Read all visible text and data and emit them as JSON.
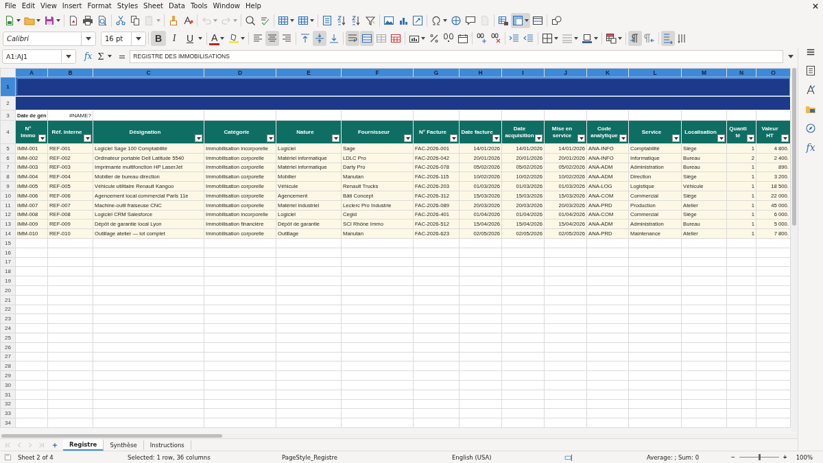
{
  "menu": [
    "File",
    "Edit",
    "View",
    "Insert",
    "Format",
    "Styles",
    "Sheet",
    "Data",
    "Tools",
    "Window",
    "Help"
  ],
  "toolbar_state": {
    "paste_enabled": false,
    "undo_enabled": false,
    "redo_enabled": false,
    "freeze_active": true
  },
  "font": {
    "name": "Calibri",
    "size": "16 pt"
  },
  "text_style_buttons": [
    {
      "label": "B",
      "kind": "bold",
      "on": true
    },
    {
      "label": "I",
      "kind": "italic",
      "on": false
    },
    {
      "label": "U",
      "kind": "underline",
      "on": false
    }
  ],
  "font_color": {
    "label": "A"
  },
  "format_state": {
    "align_left": false,
    "align_center": true,
    "align_right": false,
    "align_top": false,
    "align_middle": true,
    "align_bottom": false,
    "wrap": true,
    "merge": true,
    "left_to_right": true,
    "right_to_left": false,
    "text_horizontal": true,
    "text_vertical": false
  },
  "formula_bar": {
    "name_box": "A1:AJ1",
    "function_wizard": "fx",
    "sum": "Σ",
    "equals": "=",
    "content": "REGISTRE DES IMMOBILISATIONS"
  },
  "columns": [
    {
      "label": "A",
      "selected": true
    },
    {
      "label": "B",
      "selected": true
    },
    {
      "label": "C",
      "selected": true
    },
    {
      "label": "D",
      "selected": true
    },
    {
      "label": "E",
      "selected": true
    },
    {
      "label": "F",
      "selected": true
    },
    {
      "label": "G",
      "selected": true
    },
    {
      "label": "H",
      "selected": true
    },
    {
      "label": "I",
      "selected": true
    },
    {
      "label": "J",
      "selected": true
    },
    {
      "label": "K",
      "selected": true
    },
    {
      "label": "L",
      "selected": true
    },
    {
      "label": "M",
      "selected": true
    },
    {
      "label": "N",
      "selected": true
    },
    {
      "label": "O",
      "selected": true
    }
  ],
  "banner_rows": [
    {
      "number": "1",
      "selected": true
    },
    {
      "number": "2",
      "selected": false
    }
  ],
  "info_row": {
    "number": "3",
    "label": "Date de gén",
    "value": "#NAME?"
  },
  "header_row": {
    "number": "4",
    "cells": [
      "N° Immo",
      "Réf. interne",
      "Désignation",
      "Catégorie",
      "Nature",
      "Fournisseur",
      "N° Facture",
      "Date facture",
      "Date acquisition",
      "Mise en service",
      "Code analytique",
      "Service",
      "Localisation",
      "Quanti té",
      "Valeur HT"
    ]
  },
  "data_rows": [
    {
      "number": "5",
      "cells": [
        "IMM-001",
        "REF-001",
        "Logiciel Sage 100 Comptabilité",
        "Immobilisation incorporelle",
        "Logiciel",
        "Sage",
        "FAC-2026-001",
        "14/01/2026",
        "14/01/2026",
        "14/01/2026",
        "ANA-INFO",
        "Comptabilité",
        "Siège",
        "1",
        "4 800."
      ]
    },
    {
      "number": "6",
      "cells": [
        "IMM-002",
        "REF-002",
        "Ordinateur portable Dell Latitude 5540",
        "Immobilisation corporelle",
        "Matériel informatique",
        "LDLC Pro",
        "FAC-2026-042",
        "20/01/2026",
        "20/01/2026",
        "20/01/2026",
        "ANA-INFO",
        "Informatique",
        "Bureau",
        "2",
        "2 400."
      ]
    },
    {
      "number": "7",
      "cells": [
        "IMM-003",
        "REF-003",
        "Imprimante multifonction HP LaserJet",
        "Immobilisation corporelle",
        "Matériel informatique",
        "Darty Pro",
        "FAC-2026-078",
        "05/02/2026",
        "05/02/2026",
        "05/02/2026",
        "ANA-ADM",
        "Administration",
        "Bureau",
        "1",
        "890."
      ]
    },
    {
      "number": "8",
      "cells": [
        "IMM-004",
        "REF-004",
        "Mobilier de bureau direction",
        "Immobilisation corporelle",
        "Mobilier",
        "Manutan",
        "FAC-2026-115",
        "10/02/2026",
        "10/02/2026",
        "10/02/2026",
        "ANA-ADM",
        "Direction",
        "Siège",
        "1",
        "3 200."
      ]
    },
    {
      "number": "9",
      "cells": [
        "IMM-005",
        "REF-005",
        "Véhicule utilitaire Renault Kangoo",
        "Immobilisation corporelle",
        "Véhicule",
        "Renault Trucks",
        "FAC-2026-203",
        "01/03/2026",
        "01/03/2026",
        "01/03/2026",
        "ANA-LOG",
        "Logistique",
        "Véhicule",
        "1",
        "18 500."
      ]
    },
    {
      "number": "10",
      "cells": [
        "IMM-006",
        "REF-006",
        "Agencement local commercial Paris 11e",
        "Immobilisation corporelle",
        "Agencement",
        "Bâti Concept",
        "FAC-2026-312",
        "15/03/2026",
        "15/03/2026",
        "15/03/2026",
        "ANA-COM",
        "Commercial",
        "Siège",
        "1",
        "22 000."
      ]
    },
    {
      "number": "11",
      "cells": [
        "IMM-007",
        "REF-007",
        "Machine-outil fraiseuse CNC",
        "Immobilisation corporelle",
        "Matériel industriel",
        "Leclerc Pro Industrie",
        "FAC-2026-089",
        "20/03/2026",
        "20/03/2026",
        "20/03/2026",
        "ANA-PRD",
        "Production",
        "Atelier",
        "1",
        "45 000."
      ]
    },
    {
      "number": "12",
      "cells": [
        "IMM-008",
        "REF-008",
        "Logiciel CRM Salesforce",
        "Immobilisation incorporelle",
        "Logiciel",
        "Cegid",
        "FAC-2026-401",
        "01/04/2026",
        "01/04/2026",
        "01/04/2026",
        "ANA-COM",
        "Commercial",
        "Siège",
        "1",
        "6 000."
      ]
    },
    {
      "number": "13",
      "cells": [
        "IMM-009",
        "REF-009",
        "Dépôt de garantie local Lyon",
        "Immobilisation financière",
        "Dépôt de garantie",
        "SCI Rhône Immo",
        "FAC-2026-512",
        "15/04/2026",
        "15/04/2026",
        "15/04/2026",
        "ANA-ADM",
        "Administration",
        "Bureau",
        "1",
        "5 000."
      ]
    },
    {
      "number": "14",
      "cells": [
        "IMM-010",
        "REF-010",
        "Outillage atelier — lot complet",
        "Immobilisation corporelle",
        "Outillage",
        "Manutan",
        "FAC-2026-623",
        "02/05/2026",
        "02/05/2026",
        "02/05/2026",
        "ANA-PRD",
        "Maintenance",
        "Atelier",
        "1",
        "7 800."
      ]
    }
  ],
  "empty_row_numbers": [
    "15",
    "16",
    "17",
    "18",
    "19",
    "20",
    "21",
    "22",
    "23",
    "24",
    "25",
    "26",
    "27",
    "28",
    "29",
    "30",
    "31",
    "32",
    "33",
    "34"
  ],
  "sidebar": {
    "functions": "fx"
  },
  "sheet_tabs": [
    {
      "label": "Registre",
      "selected": true
    },
    {
      "label": "Synthèse",
      "selected": false
    },
    {
      "label": "Instructions",
      "selected": false
    }
  ],
  "status_bar": {
    "sheet": "Sheet 2 of 4",
    "selection": "Selected: 1 row, 36 columns",
    "page_style": "PageStyle_Registre",
    "language": "English (USA)",
    "summary": "Average: ; Sum: 0",
    "zoom_out": "−",
    "zoom_in": "+",
    "zoom": "100%",
    "zoom_slider": {
      "level": 0.5
    }
  }
}
